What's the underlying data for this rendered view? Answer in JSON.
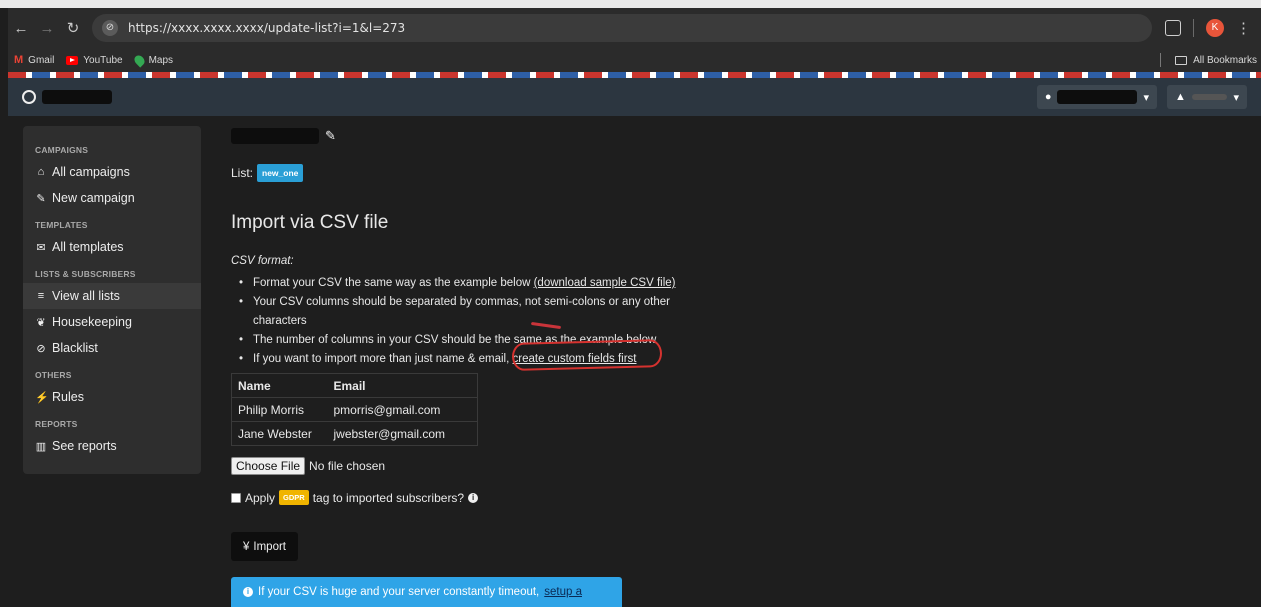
{
  "browser": {
    "url": "https://xxxx.xxxx.xxxx/update-list?i=1&l=273",
    "profile_initial": "K",
    "bookmarks": [
      {
        "label": "Gmail"
      },
      {
        "label": "YouTube"
      },
      {
        "label": "Maps"
      }
    ],
    "all_bookmarks": "All Bookmarks"
  },
  "sidebar": {
    "sections": [
      {
        "heading": "CAMPAIGNS",
        "items": [
          {
            "icon": "home-icon",
            "label": "All campaigns"
          },
          {
            "icon": "edit-icon",
            "label": "New campaign"
          }
        ]
      },
      {
        "heading": "TEMPLATES",
        "items": [
          {
            "icon": "envelope-icon",
            "label": "All templates"
          }
        ]
      },
      {
        "heading": "LISTS & SUBSCRIBERS",
        "items": [
          {
            "icon": "list-icon",
            "label": "View all lists",
            "active": true
          },
          {
            "icon": "leaf-icon",
            "label": "Housekeeping"
          },
          {
            "icon": "ban-icon",
            "label": "Blacklist"
          }
        ]
      },
      {
        "heading": "OTHERS",
        "items": [
          {
            "icon": "wand-icon",
            "label": "Rules"
          }
        ]
      },
      {
        "heading": "REPORTS",
        "items": [
          {
            "icon": "bar-chart-icon",
            "label": "See reports"
          }
        ]
      }
    ]
  },
  "main": {
    "list_label": "List:",
    "list_name": "new_one",
    "import_title": "Import via CSV file",
    "csv_format_label": "CSV format:",
    "bullets": {
      "b1_text": "Format your CSV the same way as the example below ",
      "b1_link": "(download sample CSV file)",
      "b2_text": "Your CSV columns should be separated by commas, not semi-colons or any other characters",
      "b3_text": "The number of columns in your CSV should be the same as the example below",
      "b4_text": "If you want to import more than just name & email, ",
      "b4_link": "create custom fields first"
    },
    "sample_table": {
      "headers": [
        "Name",
        "Email"
      ],
      "rows": [
        [
          "Philip Morris",
          "pmorris@gmail.com"
        ],
        [
          "Jane Webster",
          "jwebster@gmail.com"
        ]
      ]
    },
    "file_input": {
      "button_label": "Choose File",
      "status": "No file chosen"
    },
    "gdpr": {
      "prefix": "Apply",
      "badge": "GDPR",
      "suffix": "tag to imported subscribers?"
    },
    "import_button": "Import",
    "alert": {
      "text": "If your CSV is huge and your server constantly timeout,",
      "link": "setup a"
    }
  },
  "colors": {
    "accent_blue": "#2fa4e7",
    "list_badge": "#2a9fd6",
    "gdpr_badge": "#f0b400",
    "annotation_red": "#d5322f"
  }
}
